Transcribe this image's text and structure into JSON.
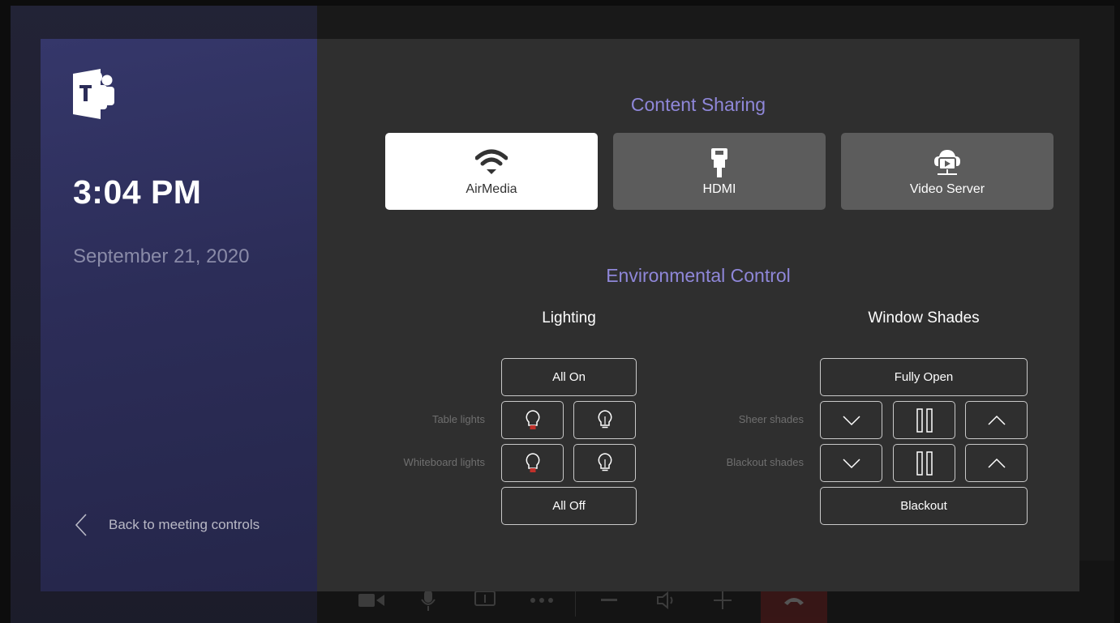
{
  "sidebar": {
    "time": "3:04 PM",
    "date": "September 21, 2020",
    "back_label": "Back to meeting controls"
  },
  "content_sharing": {
    "title": "Content Sharing",
    "sources": [
      {
        "label": "AirMedia",
        "icon": "wifi-icon",
        "active": true
      },
      {
        "label": "HDMI",
        "icon": "hdmi-icon",
        "active": false
      },
      {
        "label": "Video Server",
        "icon": "video-server-icon",
        "active": false
      }
    ]
  },
  "environmental": {
    "title": "Environmental Control",
    "lighting": {
      "title": "Lighting",
      "all_on": "All On",
      "all_off": "All Off",
      "rows": [
        {
          "label": "Table lights"
        },
        {
          "label": "Whiteboard lights"
        }
      ]
    },
    "shades": {
      "title": "Window Shades",
      "fully_open": "Fully Open",
      "blackout": "Blackout",
      "rows": [
        {
          "label": "Sheer shades"
        },
        {
          "label": "Blackout shades"
        }
      ]
    }
  },
  "colors": {
    "accent": "#8f87d9",
    "sidebar": "#2c2d58",
    "panel": "#2f2f2f",
    "active_button": "#ffffff",
    "inactive_button": "#5c5c5c",
    "bulb_off_accent": "#c0302a"
  }
}
